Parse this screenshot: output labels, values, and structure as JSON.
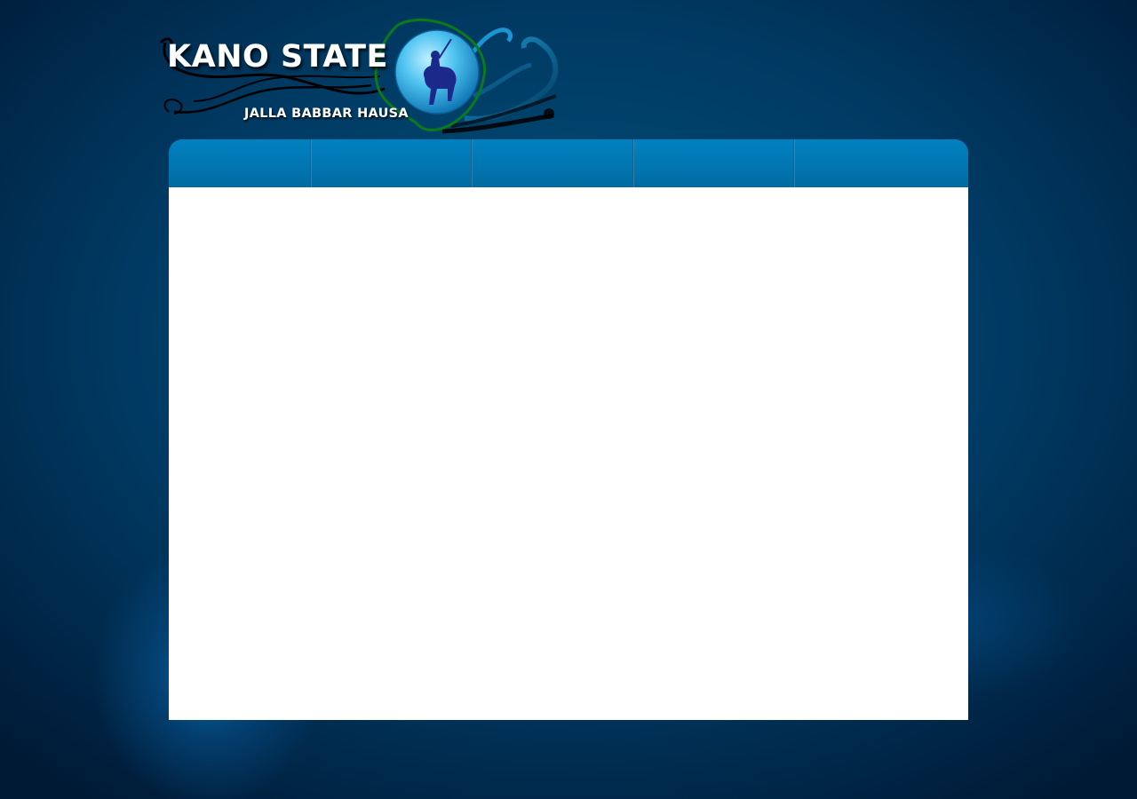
{
  "header": {
    "title": "KANO STATE",
    "tagline": "JALLA BABBAR HAUSA",
    "logo_emblem_icon": "polo-horseman-globe-icon"
  },
  "nav": {
    "items": [
      {
        "label": ""
      },
      {
        "label": ""
      },
      {
        "label": ""
      },
      {
        "label": ""
      },
      {
        "label": ""
      }
    ]
  },
  "colors": {
    "background": "#003a63",
    "nav_bar": "#0176b1",
    "content": "#ffffff",
    "title_text": "#ffffff"
  }
}
